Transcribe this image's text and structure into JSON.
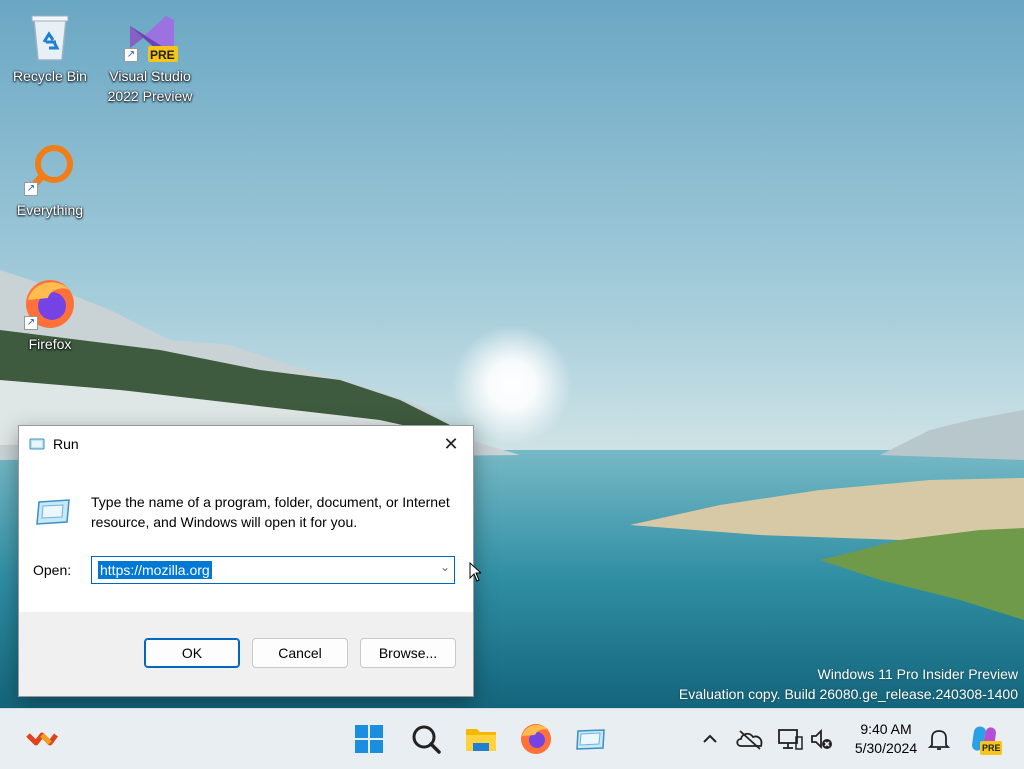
{
  "desktop": {
    "icons": [
      {
        "label": "Recycle Bin",
        "icon": "recycle-bin-icon"
      },
      {
        "label": "Visual Studio 2022 Preview",
        "label_line1": "Visual Studio",
        "label_line2": "2022 Preview",
        "badge": "PRE",
        "icon": "visual-studio-icon"
      },
      {
        "label": "Everything",
        "icon": "everything-search-icon"
      },
      {
        "label": "Firefox",
        "icon": "firefox-icon"
      }
    ]
  },
  "run_dialog": {
    "title": "Run",
    "description": "Type the name of a program, folder, document, or Internet resource, and Windows will open it for you.",
    "open_label": "Open:",
    "open_value": "https://mozilla.org",
    "ok_label": "OK",
    "cancel_label": "Cancel",
    "browse_label": "Browse...",
    "close_glyph": "✕"
  },
  "watermark": {
    "line1": "Windows 11 Pro Insider Preview",
    "line2": "Evaluation copy. Build 26080.ge_release.240308-1400"
  },
  "taskbar": {
    "pinned": [
      "widgets-icon",
      "start-icon",
      "search-icon",
      "file-explorer-icon",
      "firefox-icon",
      "run-icon"
    ],
    "tray": [
      "chevron-up-icon",
      "onedrive-icon",
      "network-icon",
      "volume-muted-icon",
      "notification-bell-icon",
      "copilot-icon"
    ],
    "copilot_badge": "PRE",
    "time": "9:40 AM",
    "date": "5/30/2024"
  },
  "colors": {
    "accent": "#0078d4",
    "taskbar_bg": "#e9eef3"
  }
}
